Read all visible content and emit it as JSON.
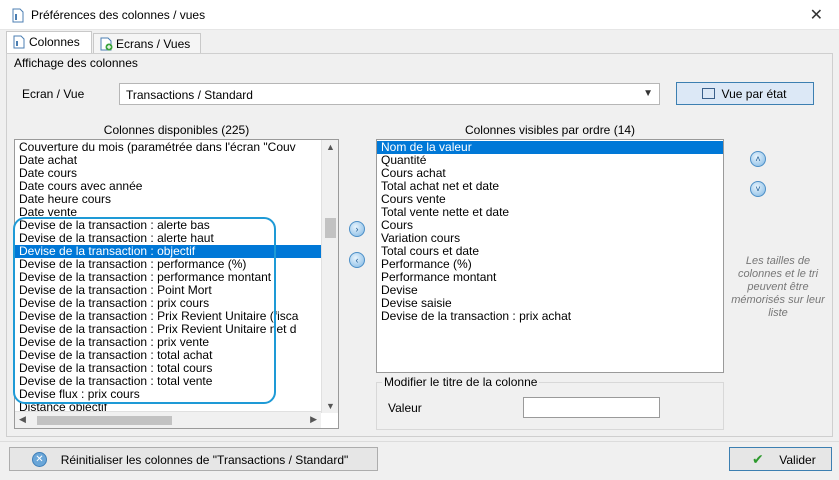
{
  "window": {
    "title": "Préférences des colonnes / vues",
    "close_glyph": "✕"
  },
  "tabs": [
    {
      "label": "Colonnes",
      "icon": "column-doc-icon",
      "active": true
    },
    {
      "label": "Ecrans / Vues",
      "icon": "screen-add-icon",
      "active": false
    }
  ],
  "section": {
    "label": "Affichage des colonnes"
  },
  "ecran": {
    "label": "Ecran / Vue",
    "value": "Transactions / Standard",
    "button_label": "Vue par état"
  },
  "available": {
    "title": "Colonnes disponibles (225)",
    "items": [
      "Couverture du mois (paramétrée dans l'écran \"Couv",
      "Date achat",
      "Date cours",
      "Date cours avec année",
      "Date heure cours",
      "Date vente",
      "Devise de la transaction : alerte bas",
      "Devise de la transaction : alerte haut",
      "Devise de la transaction : objectif",
      "Devise de la transaction : performance (%)",
      "Devise de la transaction : performance montant",
      "Devise de la transaction : Point Mort",
      "Devise de la transaction : prix cours",
      "Devise de la transaction : Prix Revient Unitaire (fisca",
      "Devise de la transaction : Prix Revient Unitaire net d",
      "Devise de la transaction : prix vente",
      "Devise de la transaction : total achat",
      "Devise de la transaction : total cours",
      "Devise de la transaction : total vente",
      "Devise flux : prix cours",
      "Distance objectif"
    ],
    "selected_index": 8
  },
  "visible": {
    "title": "Colonnes visibles par ordre (14)",
    "items": [
      "Nom de la valeur",
      "Quantité",
      "Cours achat",
      "Total achat net et date",
      "Cours vente",
      "Total vente nette et date",
      "Cours",
      "Variation cours",
      "Total cours et date",
      "Performance (%)",
      "Performance montant",
      "Devise",
      "Devise saisie",
      "Devise de la transaction : prix achat"
    ],
    "selected_index": 0
  },
  "move_buttons": {
    "add": "›",
    "remove": "‹",
    "up": "˄",
    "down": "˅"
  },
  "hint": "Les tailles de colonnes et le tri peuvent être mémorisés sur leur liste",
  "modify": {
    "legend": "Modifier le titre de la colonne",
    "label": "Valeur",
    "value": ""
  },
  "footer": {
    "reset_label": "Réinitialiser les colonnes de \"Transactions / Standard\"",
    "ok_label": "Valider"
  },
  "colors": {
    "selection": "#0078d7",
    "highlight": "#1e9ad6",
    "accent": "#3c7fb1"
  }
}
